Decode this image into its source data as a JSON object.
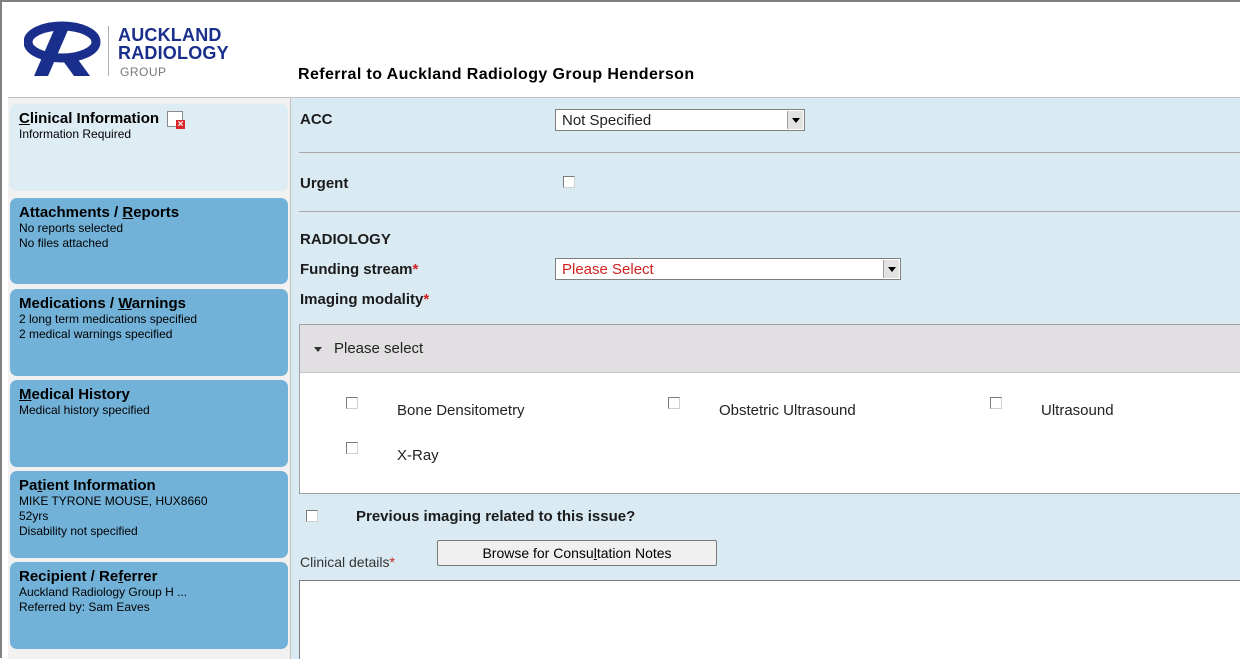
{
  "brand": {
    "line1": "AUCKLAND",
    "line2": "RADIOLOGY",
    "line3": "GROUP",
    "color": "#1a2f8c"
  },
  "page_title": "Referral to Auckland Radiology Group Henderson",
  "sidebar": {
    "items": [
      {
        "title_pre": "",
        "title_u": "C",
        "title_post": "linical Information",
        "lines": [
          "Information Required"
        ],
        "icon": "required-icon"
      },
      {
        "title_pre": "Attachments / ",
        "title_u": "R",
        "title_post": "eports",
        "lines": [
          "No reports selected",
          "No files attached"
        ]
      },
      {
        "title_pre": "Medications / ",
        "title_u": "W",
        "title_post": "arnings",
        "lines": [
          "2 long term medications specified",
          "2 medical warnings specified"
        ]
      },
      {
        "title_pre": "",
        "title_u": "M",
        "title_post": "edical History",
        "lines": [
          "Medical history specified"
        ]
      },
      {
        "title_pre": "Pa",
        "title_u": "t",
        "title_post": "ient Information",
        "lines": [
          "MIKE TYRONE MOUSE, HUX8660",
          "52yrs",
          "Disability not specified"
        ]
      },
      {
        "title_pre": "Recipient / Re",
        "title_u": "f",
        "title_post": "errer",
        "lines": [
          "Auckland Radiology Group H ...",
          "Referred by: Sam Eaves"
        ]
      }
    ]
  },
  "form": {
    "acc": {
      "label": "ACC",
      "value": "Not Specified"
    },
    "urgent": {
      "label": "Urgent",
      "checked": false
    },
    "radiology_heading": "RADIOLOGY",
    "funding": {
      "label": "Funding stream",
      "required_mark": "*",
      "value": "Please Select",
      "value_color": "#d02020"
    },
    "imaging": {
      "label": "Imaging modality",
      "required_mark": "*",
      "dropdown_text": "Please select",
      "options": [
        "Bone Densitometry",
        "Obstetric Ultrasound",
        "Ultrasound",
        "X-Ray"
      ]
    },
    "previous_imaging": {
      "label": "Previous imaging related to this issue?",
      "checked": false
    },
    "clinical_details": {
      "label": "Clinical details",
      "required_mark": "*",
      "browse_pre": "Browse for Consu",
      "browse_u": "l",
      "browse_post": "tation Notes",
      "value": ""
    }
  }
}
